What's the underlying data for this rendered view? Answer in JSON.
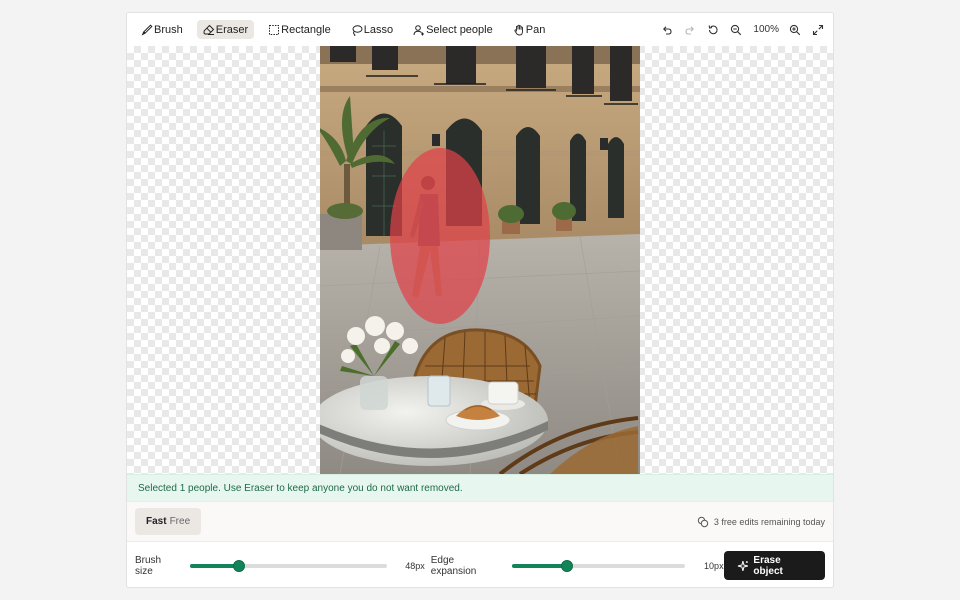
{
  "toolbar": {
    "tools": [
      {
        "label": "Brush",
        "icon": "brush-icon",
        "active": false
      },
      {
        "label": "Eraser",
        "icon": "eraser-icon",
        "active": true
      },
      {
        "label": "Rectangle",
        "icon": "rectangle-icon",
        "active": false
      },
      {
        "label": "Lasso",
        "icon": "lasso-icon",
        "active": false
      },
      {
        "label": "Select people",
        "icon": "person-icon",
        "active": false
      },
      {
        "label": "Pan",
        "icon": "hand-icon",
        "active": false
      }
    ],
    "zoom": "100%",
    "right_icons": [
      "undo-icon",
      "redo-icon",
      "reset-icon",
      "zoom-out-icon",
      "zoom-in-icon",
      "fullscreen-icon"
    ]
  },
  "banner": {
    "message": "Selected 1 people. Use Eraser to keep anyone you do not want removed."
  },
  "mode": {
    "name": "Fast",
    "tier": "Free"
  },
  "credits": {
    "text": "3 free edits remaining today"
  },
  "controls": {
    "brush_size_label": "Brush size",
    "brush_size_value": "48px",
    "brush_size_fraction": 0.25,
    "edge_label": "Edge expansion",
    "edge_value": "10px",
    "edge_fraction": 0.32,
    "erase_label": "Erase object"
  },
  "colors": {
    "accent": "#13845a",
    "selection_mask": "#e0414a",
    "banner_bg": "#e7f7ef"
  }
}
